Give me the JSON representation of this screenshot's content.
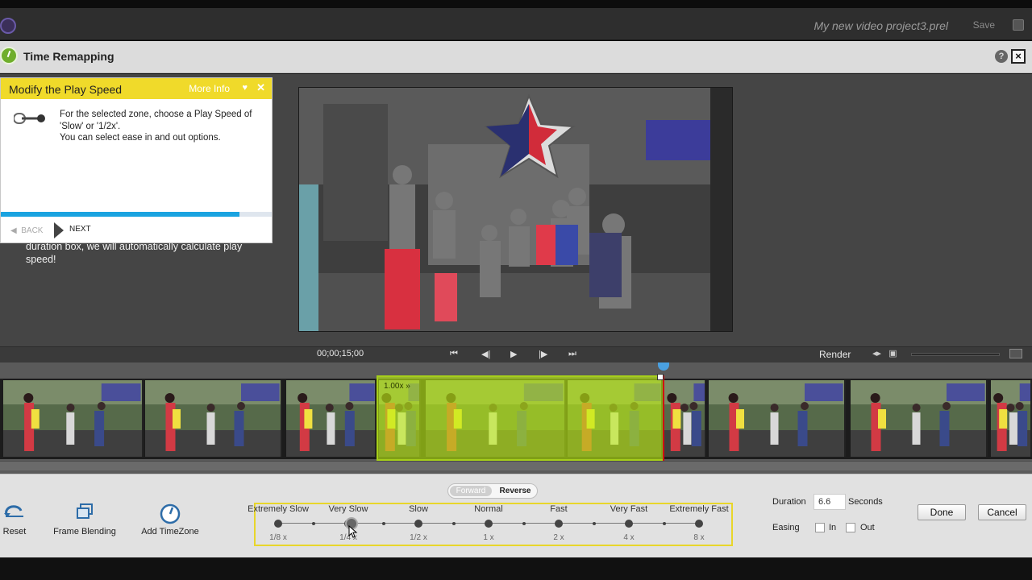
{
  "topbar": {
    "project_title": "My new video project3.prel",
    "save_label": "Save"
  },
  "panel": {
    "title": "Time Remapping"
  },
  "tip": {
    "title": "Modify the Play Speed",
    "more_info": "More Info",
    "body": "For the selected zone, choose a Play Speed of 'Slow' or '1/2x'.\nYou can select ease in and out options.",
    "back_label": "BACK",
    "next_label": "NEXT",
    "progress": 0.88,
    "behind_text": "duration box, we will automatically calculate play speed!"
  },
  "transport": {
    "timecode": "00;00;15;00",
    "render_label": "Render"
  },
  "timeline": {
    "zone_label": "1.00x »"
  },
  "direction": {
    "forward_label": "Forward",
    "reverse_label": "Reverse",
    "selected": "Reverse"
  },
  "tools": [
    {
      "label": "Reset"
    },
    {
      "label": "Frame Blending"
    },
    {
      "label": "Add TimeZone"
    }
  ],
  "speed": {
    "labels": [
      "Extremely Slow",
      "Very Slow",
      "Slow",
      "Normal",
      "Fast",
      "Very Fast",
      "Extremely Fast"
    ],
    "values": [
      "1/8 x",
      "1/4 x",
      "1/2 x",
      "1 x",
      "2 x",
      "4 x",
      "8 x"
    ],
    "selected": "Very Slow"
  },
  "duration": {
    "label": "Duration",
    "value": "6.6",
    "unit": "Seconds"
  },
  "easing": {
    "label": "Easing",
    "in_label": "In",
    "out_label": "Out",
    "in_checked": false,
    "out_checked": false
  },
  "actions": {
    "done_label": "Done",
    "cancel_label": "Cancel"
  },
  "colors": {
    "accent_yellow": "#f0da2a",
    "zone_green": "#bef014",
    "progress_blue": "#1aa3e0"
  }
}
